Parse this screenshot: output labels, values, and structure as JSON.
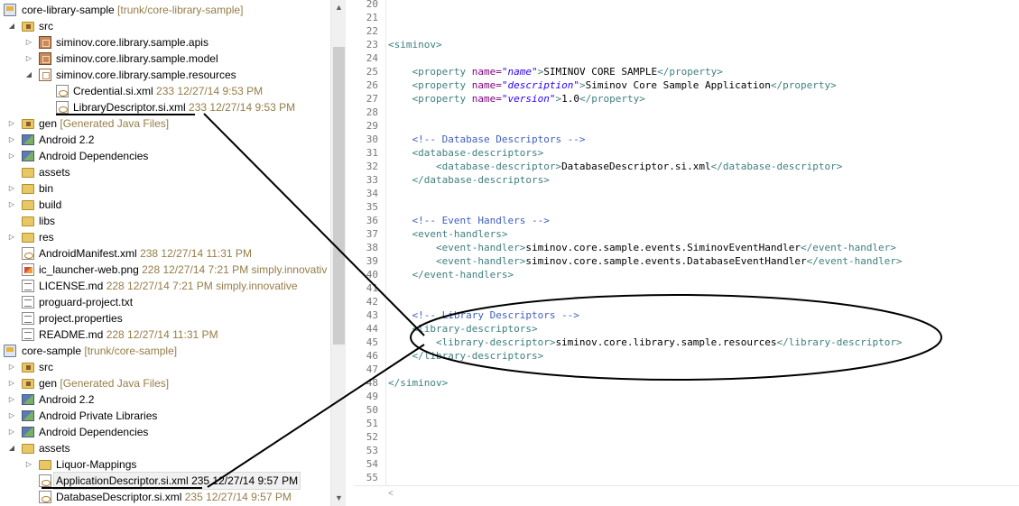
{
  "explorer": {
    "rows": [
      {
        "label": "core-library-sample",
        "deco": "[trunk/core-library-sample]",
        "meta": ""
      },
      {
        "label": "src",
        "deco": "",
        "meta": ""
      },
      {
        "label": "siminov.core.library.sample.apis",
        "deco": "",
        "meta": ""
      },
      {
        "label": "siminov.core.library.sample.model",
        "deco": "",
        "meta": ""
      },
      {
        "label": "siminov.core.library.sample.resources",
        "deco": "",
        "meta": ""
      },
      {
        "label": "Credential.si.xml",
        "deco": "",
        "meta": "233  12/27/14 9:53 PM"
      },
      {
        "label": "LibraryDescriptor.si.xml",
        "deco": "",
        "meta": "233  12/27/14 9:53 PM"
      },
      {
        "label": "gen",
        "deco": "[Generated Java Files]",
        "meta": ""
      },
      {
        "label": "Android 2.2",
        "deco": "",
        "meta": ""
      },
      {
        "label": "Android Dependencies",
        "deco": "",
        "meta": ""
      },
      {
        "label": "assets",
        "deco": "",
        "meta": ""
      },
      {
        "label": "bin",
        "deco": "",
        "meta": ""
      },
      {
        "label": "build",
        "deco": "",
        "meta": ""
      },
      {
        "label": "libs",
        "deco": "",
        "meta": ""
      },
      {
        "label": "res",
        "deco": "",
        "meta": ""
      },
      {
        "label": "AndroidManifest.xml",
        "deco": "",
        "meta": "238  12/27/14 11:31 PM"
      },
      {
        "label": "ic_launcher-web.png",
        "deco": "",
        "meta": "228  12/27/14 7:21 PM  simply.innovativ"
      },
      {
        "label": "LICENSE.md",
        "deco": "",
        "meta": "228  12/27/14 7:21 PM  simply.innovative"
      },
      {
        "label": "proguard-project.txt",
        "deco": "",
        "meta": ""
      },
      {
        "label": "project.properties",
        "deco": "",
        "meta": ""
      },
      {
        "label": "README.md",
        "deco": "",
        "meta": "228  12/27/14 11:31 PM"
      },
      {
        "label": "core-sample",
        "deco": "[trunk/core-sample]",
        "meta": ""
      },
      {
        "label": "src",
        "deco": "",
        "meta": ""
      },
      {
        "label": "gen",
        "deco": "[Generated Java Files]",
        "meta": ""
      },
      {
        "label": "Android 2.2",
        "deco": "",
        "meta": ""
      },
      {
        "label": "Android Private Libraries",
        "deco": "",
        "meta": ""
      },
      {
        "label": "Android Dependencies",
        "deco": "",
        "meta": ""
      },
      {
        "label": "assets",
        "deco": "",
        "meta": ""
      },
      {
        "label": "Liquor-Mappings",
        "deco": "",
        "meta": ""
      },
      {
        "label": "ApplicationDescriptor.si.xml",
        "deco": "",
        "meta": "235  12/27/14 9:57 PM"
      },
      {
        "label": "DatabaseDescriptor.si.xml",
        "deco": "",
        "meta": "235  12/27/14 9:57 PM"
      }
    ],
    "scroll_up_icon": "triangle-up",
    "scroll_down_icon": "triangle-down"
  },
  "editor": {
    "line_numbers": [
      "20",
      "21",
      "22",
      "23",
      "24",
      "25",
      "26",
      "27",
      "28",
      "29",
      "30",
      "31",
      "32",
      "33",
      "34",
      "35",
      "36",
      "37",
      "38",
      "39",
      "40",
      "41",
      "42",
      "43",
      "44",
      "45",
      "46",
      "47",
      "48",
      "49",
      "50",
      "51",
      "52",
      "53",
      "54",
      "55"
    ],
    "lines": {
      "l23_tag": "<siminov>",
      "l25_open": "<property ",
      "l25_attr": "name=",
      "l25_val": "\"name\"",
      "l25_gt": ">",
      "l25_text": "SIMINOV CORE SAMPLE",
      "l25_close": "</property>",
      "l26_open": "<property ",
      "l26_attr": "name=",
      "l26_val": "\"description\"",
      "l26_gt": ">",
      "l26_text": "Siminov Core Sample Application",
      "l26_close": "</property>",
      "l27_open": "<property ",
      "l27_attr": "name=",
      "l27_val": "\"version\"",
      "l27_gt": ">",
      "l27_text": "1.0",
      "l27_close": "</property>",
      "l30_cmt": "<!-- Database Descriptors -->",
      "l31_tag": "<database-descriptors>",
      "l32_open": "<database-descriptor>",
      "l32_text": "DatabaseDescriptor.si.xml",
      "l32_close": "</database-descriptor>",
      "l33_tag": "</database-descriptors>",
      "l36_cmt": "<!-- Event Handlers -->",
      "l37_tag": "<event-handlers>",
      "l38_open": "<event-handler>",
      "l38_text": "siminov.core.sample.events.SiminovEventHandler",
      "l38_close": "</event-handler>",
      "l39_open": "<event-handler>",
      "l39_text": "siminov.core.sample.events.DatabaseEventHandler",
      "l39_close": "</event-handler>",
      "l40_tag": "</event-handlers>",
      "l43_cmt": "<!-- Library Descriptors -->",
      "l44_tag": "<library-descriptors>",
      "l45_open": "<library-descriptor>",
      "l45_text": "siminov.core.library.sample.resources",
      "l45_close": "</library-descriptor>",
      "l46_tag": "</library-descriptors>",
      "l48_tag": "</siminov>"
    },
    "hscroll_left_icon": "chevron-left"
  },
  "colors": {
    "tag": "#3f7f7f",
    "attribute": "#7f007f",
    "attribute_value": "#2a00ff",
    "comment": "#3f5fbf",
    "decoration": "#957d47"
  }
}
